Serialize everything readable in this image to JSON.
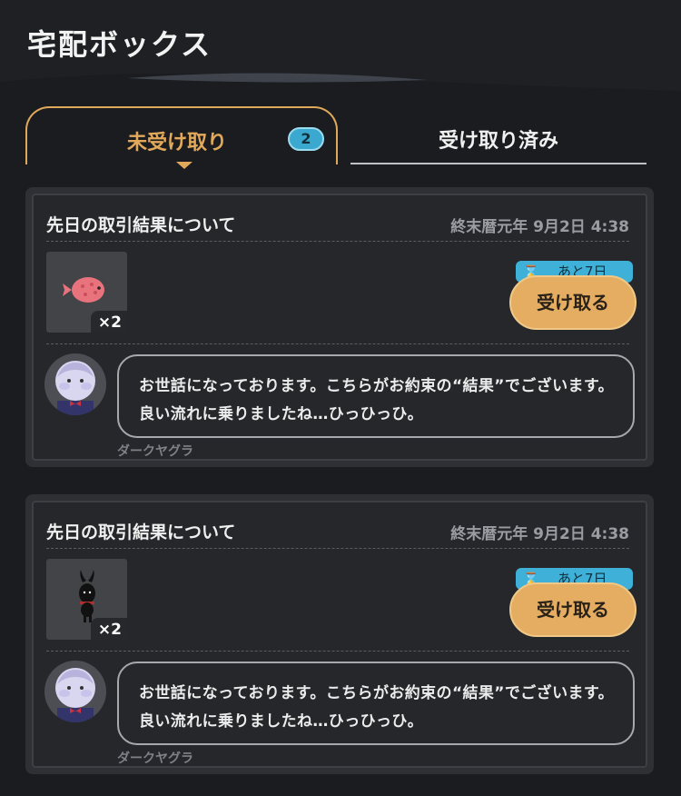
{
  "header": {
    "title": "宅配ボックス"
  },
  "tabs": [
    {
      "label": "未受け取り",
      "badge": "2",
      "active": true
    },
    {
      "label": "受け取り済み",
      "active": false
    }
  ],
  "cards": [
    {
      "title": "先日の取引結果について",
      "date": "終末暦元年 9月2日 4:38",
      "item": {
        "icon": "pink-pufferfish-icon",
        "count": "×2"
      },
      "deadline": "あと7日",
      "button": "受け取る",
      "message": "お世話になっております。こちらがお約束の“結果”でございます。良い流れに乗りましたね…ひっひっひ。",
      "sender": "ダークヤグラ"
    },
    {
      "title": "先日の取引結果について",
      "date": "終末暦元年 9月2日 4:38",
      "item": {
        "icon": "black-horned-creature-icon",
        "count": "×2"
      },
      "deadline": "あと7日",
      "button": "受け取る",
      "message": "お世話になっております。こちらがお約束の“結果”でございます。良い流れに乗りましたね…ひっひっひ。",
      "sender": "ダークヤグラ"
    }
  ],
  "colors": {
    "accent": "#e3a95b",
    "badge": "#3aa8cf",
    "background": "#1b1c20"
  }
}
